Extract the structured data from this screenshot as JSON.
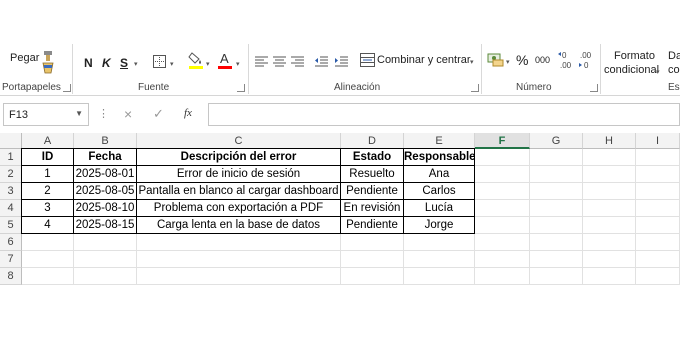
{
  "ribbon": {
    "paste_label": "Pegar",
    "bold_label": "N",
    "italic_label": "K",
    "underline_label": "S",
    "merge_label": "Combinar y centrar",
    "percent_label": "%",
    "thousands_label": "000",
    "dec_increase_label": "←0\n.00",
    "dec_decrease_label": ".00\n→0",
    "conditional_label_1": "Formato",
    "conditional_label_2": "condicional",
    "next_label_1": "Da",
    "next_label_2": "co",
    "groups": {
      "clipboard": "Portapapeles",
      "font": "Fuente",
      "alignment": "Alineación",
      "number": "Número",
      "styles": "Es"
    },
    "colors": {
      "highlight": "#ffff00",
      "font_color": "#ff0000",
      "accent": "#217346"
    }
  },
  "formula_bar": {
    "name_box": "F13",
    "cancel_icon": "×",
    "enter_icon": "✓",
    "fx_label": "fx",
    "value": ""
  },
  "sheet": {
    "columns": [
      "A",
      "B",
      "C",
      "D",
      "E",
      "F",
      "G",
      "H",
      "I"
    ],
    "selected_column": "F",
    "rows": [
      "1",
      "2",
      "3",
      "4",
      "5",
      "6",
      "7",
      "8"
    ],
    "headers": [
      "ID",
      "Fecha",
      "Descripción del error",
      "Estado",
      "Responsable"
    ],
    "data": [
      [
        "1",
        "2025-08-01",
        "Error de inicio de sesión",
        "Resuelto",
        "Ana"
      ],
      [
        "2",
        "2025-08-05",
        "Pantalla en blanco al cargar dashboard",
        "Pendiente",
        "Carlos"
      ],
      [
        "3",
        "2025-08-10",
        "Problema con exportación a PDF",
        "En revisión",
        "Lucía"
      ],
      [
        "4",
        "2025-08-15",
        "Carga lenta en la base de datos",
        "Pendiente",
        "Jorge"
      ]
    ]
  }
}
